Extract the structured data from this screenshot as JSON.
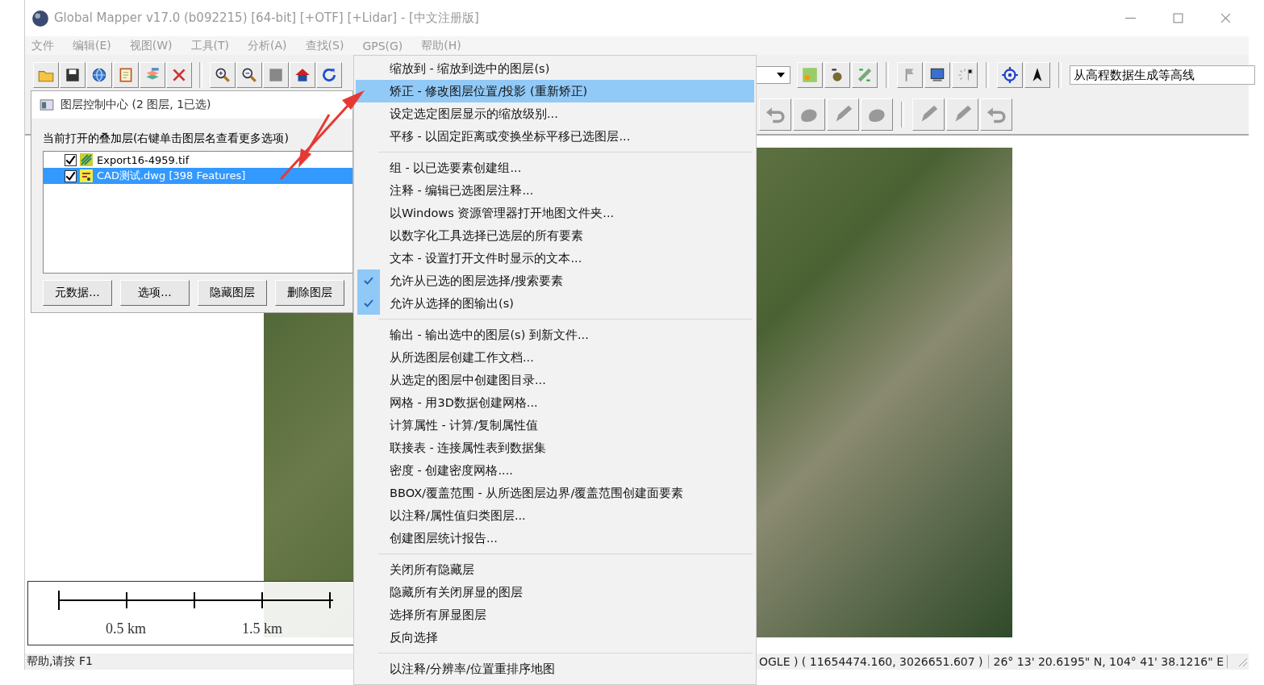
{
  "window": {
    "title": "Global Mapper v17.0 (b092215) [64-bit] [+OTF] [+Lidar] - [中文注册版]"
  },
  "menu_bar": [
    "文件",
    "编辑(E)",
    "视图(W)",
    "工具(T)",
    "分析(A)",
    "查找(S)",
    "GPS(G)",
    "帮助(H)"
  ],
  "toolbar": {
    "command_field": {
      "value": "从高程数据生成等高线"
    }
  },
  "layer_panel": {
    "title": "图层控制中心 (2 图层, 1已选)",
    "heading": "当前打开的叠加层(右键单击图层名查看更多选项)",
    "layers": [
      {
        "name": "Export16-4959.tif",
        "checked": true,
        "selected": false,
        "kind": "raster"
      },
      {
        "name": "CAD测试.dwg [398 Features]",
        "checked": true,
        "selected": true,
        "kind": "vector"
      }
    ],
    "buttons": [
      "元数据...",
      "选项...",
      "隐藏图层",
      "删除图层"
    ]
  },
  "context_menu": {
    "groups": [
      {
        "items": [
          {
            "label": "缩放到 - 缩放到选中的图层(s)",
            "selected": false,
            "checked": false
          },
          {
            "label": "矫正 - 修改图层位置/投影 (重新矫正)",
            "selected": true,
            "checked": false
          },
          {
            "label": "设定选定图层显示的缩放级别...",
            "selected": false,
            "checked": false
          },
          {
            "label": "平移 - 以固定距离或变换坐标平移已选图层...",
            "selected": false,
            "checked": false
          }
        ]
      },
      {
        "items": [
          {
            "label": "组 - 以已选要素创建组...",
            "selected": false,
            "checked": false
          },
          {
            "label": "注释 - 编辑已选图层注释...",
            "selected": false,
            "checked": false
          },
          {
            "label": "以Windows 资源管理器打开地图文件夹...",
            "selected": false,
            "checked": false
          },
          {
            "label": "以数字化工具选择已选层的所有要素",
            "selected": false,
            "checked": false
          },
          {
            "label": "文本 - 设置打开文件时显示的文本...",
            "selected": false,
            "checked": false
          },
          {
            "label": "允许从已选的图层选择/搜索要素",
            "selected": false,
            "checked": true
          },
          {
            "label": "允许从选择的图输出(s)",
            "selected": false,
            "checked": true
          }
        ]
      },
      {
        "items": [
          {
            "label": "输出 - 输出选中的图层(s) 到新文件...",
            "selected": false,
            "checked": false
          },
          {
            "label": "从所选图层创建工作文档...",
            "selected": false,
            "checked": false
          },
          {
            "label": "从选定的图层中创建图目录...",
            "selected": false,
            "checked": false
          },
          {
            "label": "网格 - 用3D数据创建网格...",
            "selected": false,
            "checked": false
          },
          {
            "label": "计算属性 - 计算/复制属性值",
            "selected": false,
            "checked": false
          },
          {
            "label": "联接表 - 连接属性表到数据集",
            "selected": false,
            "checked": false
          },
          {
            "label": "密度 - 创建密度网格....",
            "selected": false,
            "checked": false
          },
          {
            "label": "BBOX/覆盖范围  - 从所选图层边界/覆盖范围创建面要素",
            "selected": false,
            "checked": false
          },
          {
            "label": "以注释/属性值归类图层...",
            "selected": false,
            "checked": false
          },
          {
            "label": "创建图层统计报告...",
            "selected": false,
            "checked": false
          }
        ]
      },
      {
        "items": [
          {
            "label": "关闭所有隐藏层",
            "selected": false,
            "checked": false
          },
          {
            "label": "隐藏所有关闭屏显的图层",
            "selected": false,
            "checked": false
          },
          {
            "label": "选择所有屏显图层",
            "selected": false,
            "checked": false
          },
          {
            "label": "反向选择",
            "selected": false,
            "checked": false
          }
        ]
      },
      {
        "items": [
          {
            "label": "以注释/分辨率/位置重排序地图",
            "selected": false,
            "checked": false
          }
        ]
      }
    ]
  },
  "map": {
    "scale_bar": {
      "labels": [
        "0.5 km",
        "1.5 km"
      ]
    }
  },
  "status_bar": {
    "help": "帮助,请按 F1",
    "projected": "OGLE ) ( 11654474.160, 3026651.607 )",
    "geographic": "26° 13' 20.6195\" N, 104° 41' 38.1216\" E"
  }
}
